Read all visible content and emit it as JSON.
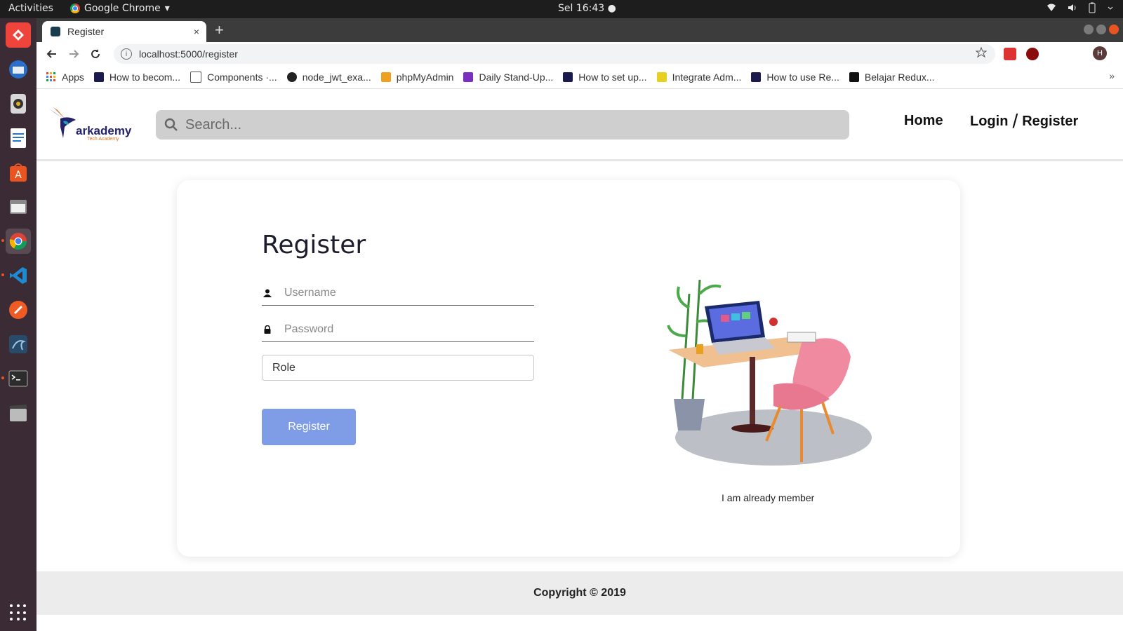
{
  "system_bar": {
    "activities": "Activities",
    "app_name": "Google Chrome",
    "app_menu_arrow": "▾",
    "clock": "Sel 16:43 ●"
  },
  "dock": {
    "apps": [
      "anydesk-icon",
      "thunderbird-icon",
      "rhythmbox-icon",
      "libreoffice-writer-icon",
      "ubuntu-software-icon",
      "files-icon",
      "chrome-icon",
      "vscode-icon",
      "postman-icon",
      "mysql-workbench-icon",
      "terminal-icon",
      "video-editor-icon"
    ],
    "show_apps": "show-applications-icon"
  },
  "browser": {
    "tab_title": "Register",
    "tab_close": "×",
    "new_tab": "+",
    "url": "localhost:5000/register",
    "bookmarks": [
      {
        "label": "Apps",
        "color": "#e8453c"
      },
      {
        "label": "How to becom...",
        "color": "#1a1a4d"
      },
      {
        "label": "Components ·...",
        "color": "#555555"
      },
      {
        "label": "node_jwt_exa...",
        "color": "#222222"
      },
      {
        "label": "phpMyAdmin",
        "color": "#f0a020"
      },
      {
        "label": "Daily Stand-Up...",
        "color": "#7b2fbe"
      },
      {
        "label": "How to set up...",
        "color": "#1a1a4d"
      },
      {
        "label": "Integrate Adm...",
        "color": "#e8d020"
      },
      {
        "label": "How to use Re...",
        "color": "#1a1a4d"
      },
      {
        "label": "Belajar Redux...",
        "color": "#111111"
      }
    ],
    "bookmarks_more": "»",
    "profile_initial": "H"
  },
  "page": {
    "logo": {
      "word": "arkademy",
      "sub": "Tech Academy"
    },
    "search_placeholder": "Search...",
    "nav": {
      "home": "Home",
      "login": "Login",
      "slash": "/",
      "register": "Register"
    },
    "form": {
      "title": "Register",
      "username_placeholder": "Username",
      "password_placeholder": "Password",
      "role_placeholder": "Role",
      "submit": "Register"
    },
    "member_link": "I am already member",
    "footer": "Copyright © 2019"
  },
  "colors": {
    "accent_button": "#7e9de6",
    "search_bg": "#cfcfcf",
    "dock_bg": "#3a2b34",
    "ubuntu_orange": "#e95420"
  }
}
